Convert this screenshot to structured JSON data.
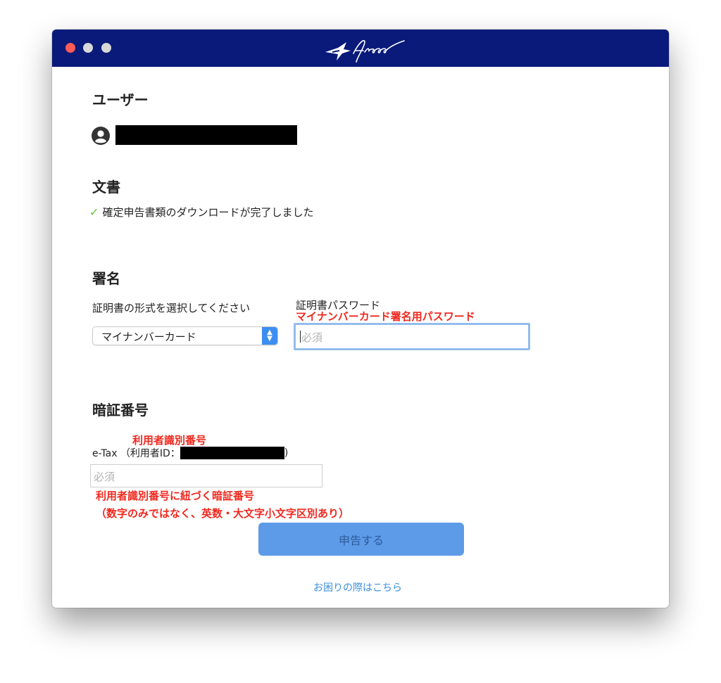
{
  "window": {
    "logo_text": "freee"
  },
  "user": {
    "heading": "ユーザー"
  },
  "document": {
    "heading": "文書",
    "status_check": "✓",
    "status_text": "確定申告書類のダウンロードが完了しました"
  },
  "signature": {
    "heading": "署名",
    "format_label": "証明書の形式を選択してください",
    "format_selected": "マイナンバーカード",
    "password_label": "証明書パスワード",
    "password_annotation": "マイナンバーカード署名用パスワード",
    "password_placeholder": "必須"
  },
  "pin": {
    "heading": "暗証番号",
    "userid_annotation": "利用者識別番号",
    "etax_label": "e-Tax （利用者ID：",
    "etax_close": ")",
    "pin_placeholder": "必須",
    "pin_annotation_1": "利用者識別番号に紐づく暗証番号",
    "pin_annotation_2": "（数字のみではなく、英数・大文字小文字区別あり）"
  },
  "actions": {
    "submit_label": "申告する",
    "help_link": "お困りの際はこちら"
  },
  "colors": {
    "titlebar": "#0a1a7a",
    "annotation_red": "#f0281e",
    "submit_button": "#5d9be8",
    "link": "#3a8fdc",
    "check_green": "#5ec33a"
  }
}
